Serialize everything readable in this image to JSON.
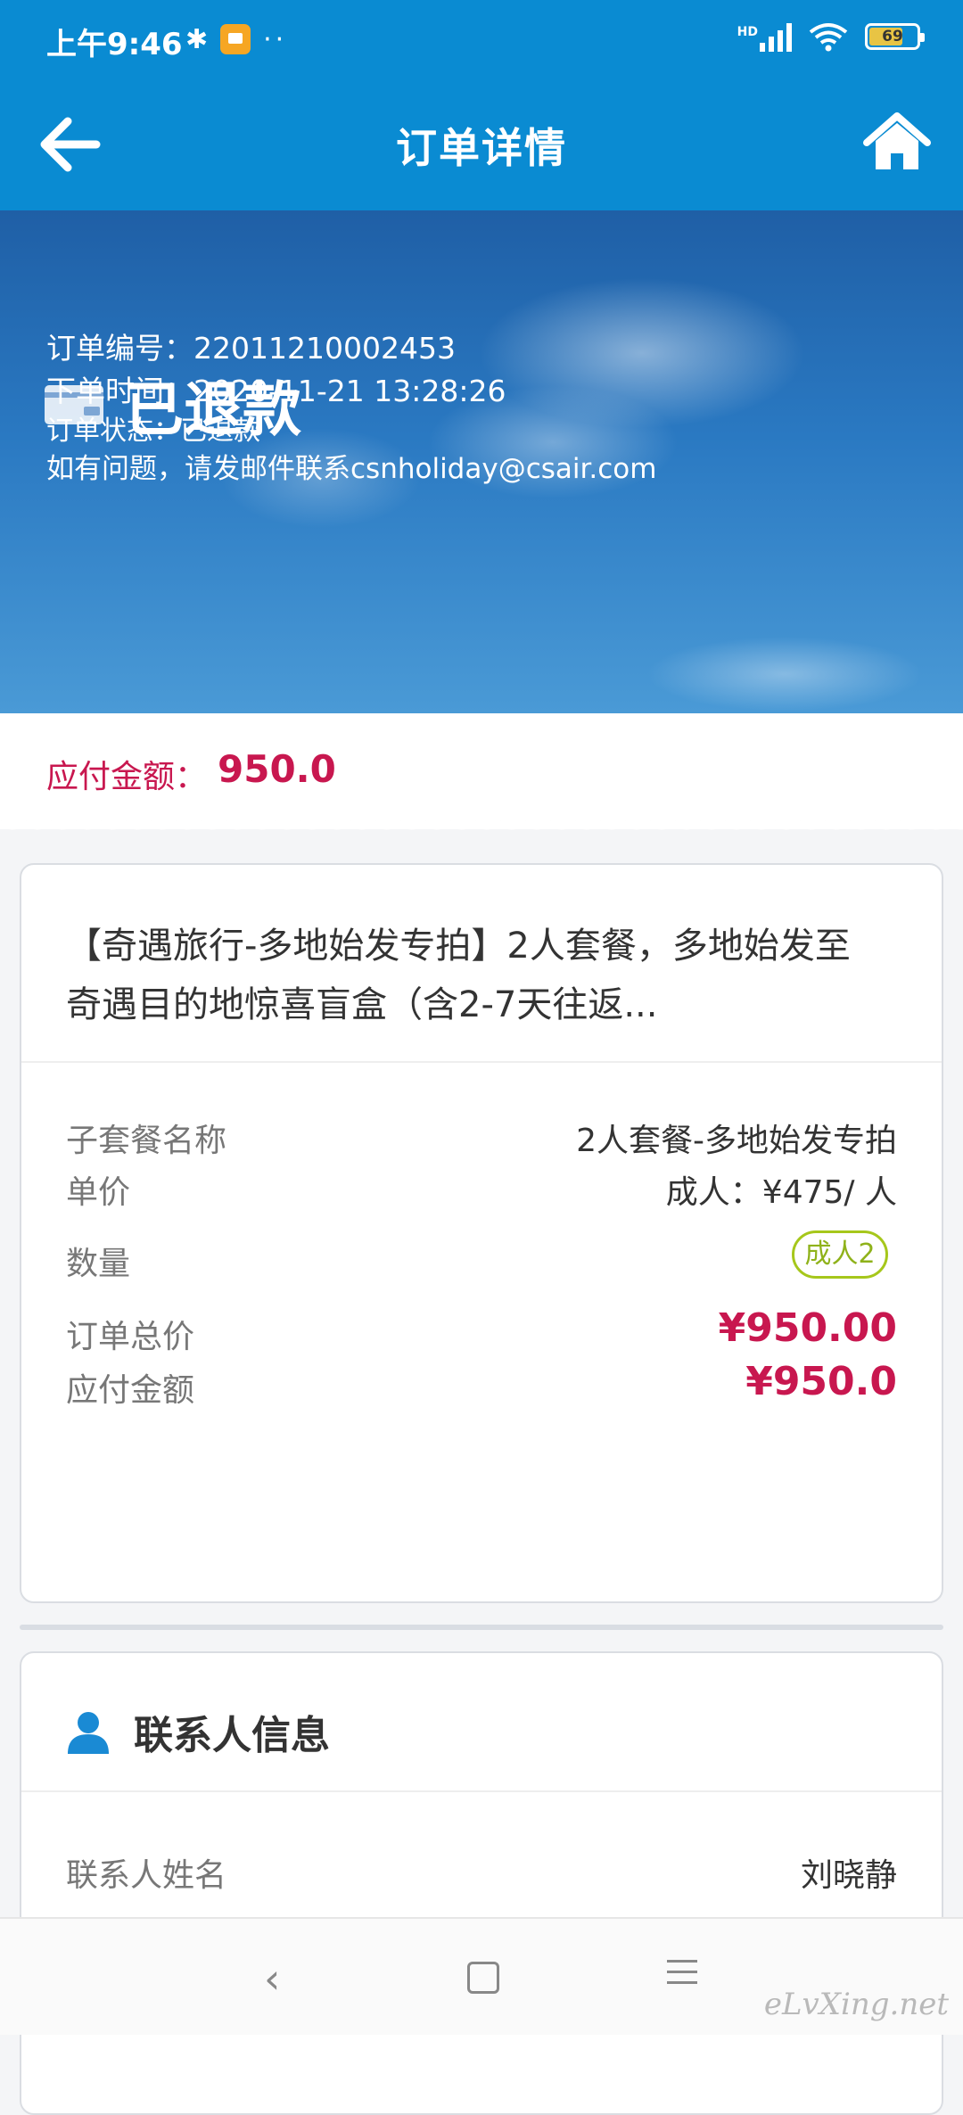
{
  "status_bar": {
    "time": "上午9:46",
    "battery": "69",
    "network": "HD"
  },
  "header": {
    "title": "订单详情"
  },
  "order": {
    "status_title": "已退款",
    "number_label": "订单编号：",
    "number_value": "22011210002453",
    "time_label": "下单时间：",
    "time_value": "2020-11-21 13:28:26",
    "state_label": "订单状态：",
    "state_value": "已退款",
    "contact_note": "如有问题，请发邮件联系csnholiday@csair.com"
  },
  "payable": {
    "label": "应付金额：",
    "value": "950.0"
  },
  "product": {
    "title": "【奇遇旅行-多地始发专拍】2人套餐，多地始发至奇遇目的地惊喜盲盒（含2-7天往返...",
    "rows": [
      {
        "label": "子套餐名称",
        "value": "2人套餐-多地始发专拍"
      },
      {
        "label": "单价",
        "value": "成人：¥475/ 人"
      },
      {
        "label": "数量",
        "value": "成人2"
      },
      {
        "label": "订单总价",
        "value": "¥950.00"
      },
      {
        "label": "应付金额",
        "value": "¥950.0"
      }
    ]
  },
  "contact": {
    "title": "联系人信息",
    "name_label": "联系人姓名",
    "name_value": "刘晓静"
  },
  "watermark": "eLvXing.net",
  "colors": {
    "primary": "#0a8bd2",
    "price": "#c8174f",
    "badge": "#a6c71b"
  },
  "icons": [
    "bluetooth-icon",
    "app-notification-icon",
    "signal-icon",
    "wifi-icon",
    "battery-icon",
    "back-arrow-icon",
    "home-icon",
    "wallet-icon",
    "person-icon"
  ]
}
